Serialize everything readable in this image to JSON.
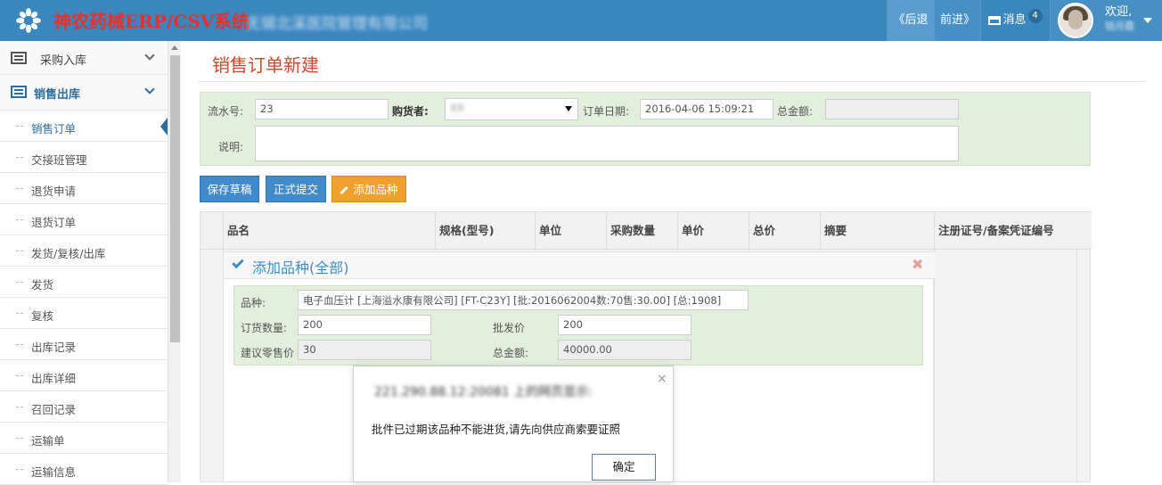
{
  "header": {
    "brand": "神农药械ERP/CSV系统",
    "company": "无锡北溪医院管理有限公司",
    "nav_back": "《后退",
    "nav_forward": "前进》",
    "messages_label": "消息",
    "messages_count": "4",
    "welcome": "欢迎,",
    "username": "钱月霞",
    "accent_color": "#3a87c0"
  },
  "sidebar": {
    "groups": [
      {
        "label": "采购入库",
        "icon": "list-icon",
        "expanded": false
      },
      {
        "label": "销售出库",
        "icon": "list-icon",
        "expanded": true
      }
    ],
    "items": [
      {
        "label": "销售订单",
        "active": true
      },
      {
        "label": "交接班管理"
      },
      {
        "label": "退货申请"
      },
      {
        "label": "退货订单"
      },
      {
        "label": "发货/复核/出库"
      },
      {
        "label": "发货"
      },
      {
        "label": "复核"
      },
      {
        "label": "出库记录"
      },
      {
        "label": "出库详细"
      },
      {
        "label": "召回记录"
      },
      {
        "label": "运输单"
      },
      {
        "label": "运输信息"
      }
    ]
  },
  "page": {
    "title": "销售订单新建",
    "title_color": "#d0482b"
  },
  "form": {
    "serial_label": "流水号:",
    "serial_value": "23",
    "buyer_label": "购货者:",
    "buyer_value": "XX",
    "order_date_label": "订单日期:",
    "order_date_value": "2016-04-06 15:09:21",
    "total_label": "总金额:",
    "total_value": "",
    "note_label": "说明:",
    "note_value": ""
  },
  "buttons": {
    "save_draft": "保存草稿",
    "submit": "正式提交",
    "add_item": "添加品种"
  },
  "table": {
    "columns": [
      "品名",
      "规格(型号)",
      "单位",
      "采购数量",
      "单价",
      "总价",
      "摘要",
      "注册证号/备案凭证编号"
    ]
  },
  "add_panel": {
    "title": "添加品种(全部)",
    "item_label": "品种:",
    "item_value": "电子血压计 [上海溢水康有限公司] [FT-C23Y] [批:2016062004数:70售:30.00] [总:1908]",
    "qty_label": "订货数量:",
    "qty_value": "200",
    "wholesale_label": "批发价",
    "wholesale_value": "200",
    "retail_label": "建议零售价",
    "retail_value": "30",
    "amount_label": "总金额:",
    "amount_value": "40000.00"
  },
  "dialog": {
    "title": "221.290.88.12:20081 上的网页显示:",
    "message": "批件已过期该品种不能进货,请先向供应商索要证照",
    "ok_label": "确定"
  }
}
